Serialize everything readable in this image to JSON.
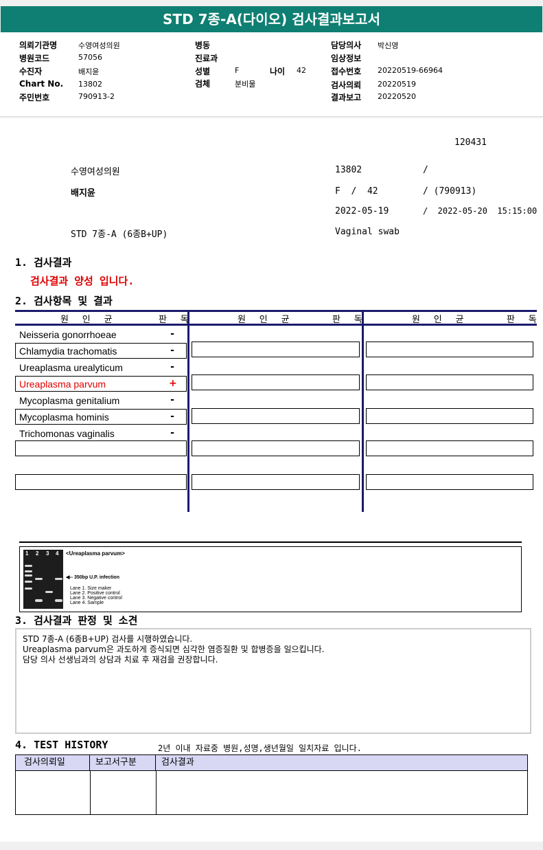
{
  "title": "STD 7종-A(다이오) 검사결과보고서",
  "header": {
    "institution_label": "의뢰기관명",
    "institution": "수영여성의원",
    "ward_label": "병동",
    "doctor_label": "담당의사",
    "doctor": "박신영",
    "hospital_code_label": "병원코드",
    "hospital_code": "57056",
    "dept_label": "진료과",
    "clinical_label": "임상정보",
    "patient_label": "수진자",
    "patient": "배지윤",
    "sex_label": "성별",
    "sex": "F",
    "age_label": "나이",
    "age": "42",
    "receipt_label": "접수번호",
    "receipt": "20220519-66964",
    "chart_label": "Chart No.",
    "chart": "13802",
    "specimen_label": "검체",
    "specimen": "분비물",
    "request_label": "검사의뢰",
    "request": "20220519",
    "rrn_label": "주민번호",
    "rrn": "790913-2",
    "report_label": "결과보고",
    "report": "20220520"
  },
  "summary": {
    "code": "120431",
    "institution": "수영여성의원",
    "chart": "13802",
    "slash": "/",
    "patient": "배지윤",
    "sex_age": "F  /  42",
    "birth": "/ (790913)",
    "date": "2022-05-19",
    "datetime": "/  2022-05-20  15:15:00",
    "test": "STD 7종-A (6종B+UP)",
    "specimen": "Vaginal swab"
  },
  "section1": {
    "title": "1. 검사결과",
    "result": "검사결과 양성 입니다."
  },
  "section2": {
    "title": "2. 검사항목 및 결과",
    "col_pathogen": "원 인 균",
    "col_judge": "판 독",
    "rows": [
      {
        "organism": "Neisseria gonorrhoeae",
        "result": "-"
      },
      {
        "organism": "Chlamydia trachomatis",
        "result": "-"
      },
      {
        "organism": "Ureaplasma urealyticum",
        "result": "-"
      },
      {
        "organism": "Ureaplasma parvum",
        "result": "+"
      },
      {
        "organism": "Mycoplasma genitalium",
        "result": "-"
      },
      {
        "organism": "Mycoplasma hominis",
        "result": "-"
      },
      {
        "organism": "Trichomonas vaginalis",
        "result": "-"
      }
    ]
  },
  "gel": {
    "lanes": [
      "1",
      "2",
      "3",
      "4"
    ],
    "title": "<Ureaplasma parvum>",
    "marker": "◀-- 350bp U.P. infection",
    "legend": [
      "Lane 1. Size maker",
      "Lane 2. Positive control",
      "Lane 3. Negative control",
      "Lane 4. Sample"
    ]
  },
  "section3": {
    "title": "3. 검사결과 판정 및 소견",
    "lines": [
      "STD 7종-A (6종B+UP) 검사를 시행하였습니다.",
      "Ureaplasma parvum은  과도하게 증식되면 심각한 염증질환 및 합병증을 일으킵니다.",
      "담당 의사 선생님과의 상담과 치료 후 재검을 권장합니다."
    ]
  },
  "section4": {
    "title": "4. TEST HISTORY",
    "note": "2년 이내 자료중 병원,성명,생년월일 일치자료 입니다.",
    "columns": [
      "검사의뢰일",
      "보고서구분",
      "검사결과"
    ]
  },
  "colors": {
    "title_bg": "#0e7f72",
    "table_border": "#1a1a6e",
    "positive": "#e00000"
  }
}
